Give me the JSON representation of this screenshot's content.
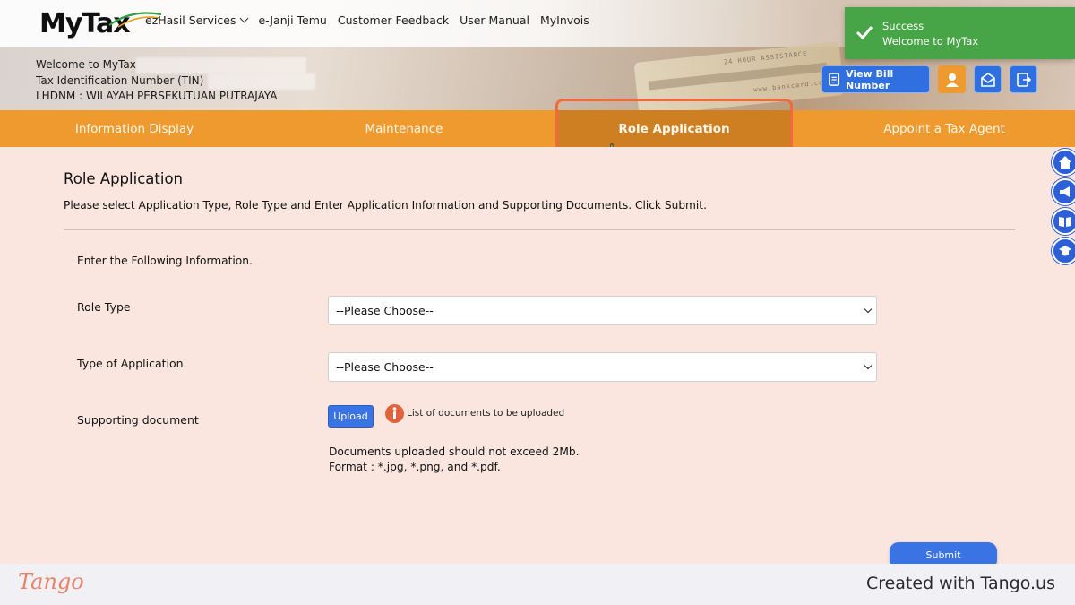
{
  "header": {
    "logo": "MyTax",
    "nav": [
      {
        "label": "ezHasil Services",
        "has_dropdown": true
      },
      {
        "label": "e-Janji Temu",
        "has_dropdown": false
      },
      {
        "label": "Customer Feedback",
        "has_dropdown": false
      },
      {
        "label": "User Manual",
        "has_dropdown": false
      },
      {
        "label": "MyInvois",
        "has_dropdown": false
      }
    ],
    "welcome_line": "Welcome to MyTax",
    "tin_line": "Tax Identification Number (TIN)",
    "lhdnm_line": "LHDNM : WILAYAH PERSEKUTUAN PUTRAJAYA",
    "view_bill_label": "View Bill Number",
    "icons": [
      "profile-icon",
      "mail-icon",
      "logout-icon"
    ]
  },
  "toast": {
    "title": "Success",
    "message": "Welcome to MyTax",
    "color": "#47a447"
  },
  "main_nav": {
    "tabs": [
      {
        "label": "Information Display",
        "active": false
      },
      {
        "label": "Maintenance",
        "active": false
      },
      {
        "label": "Role Application",
        "active": true
      },
      {
        "label": "Appoint a Tax Agent",
        "active": false
      }
    ],
    "color": "#ee9a2e",
    "active_color": "#cd7f22"
  },
  "content": {
    "title": "Role Application",
    "description": "Please select Application Type, Role Type and Enter Application Information and Supporting Documents. Click Submit.",
    "form_intro": "Enter the Following Information.",
    "fields": {
      "role_type": {
        "label": "Role Type",
        "value": "--Please Choose--"
      },
      "type_of_application": {
        "label": "Type of Application",
        "value": "--Please Choose--"
      },
      "supporting_document": {
        "label": "Supporting document"
      }
    },
    "upload_label": "Upload",
    "upload_note": "List of documents to be uploaded",
    "size_note": "Documents uploaded should not exceed 2Mb.",
    "format_note": "Format : *.jpg, *.png, and *.pdf.",
    "submit_label": "Submit"
  },
  "side_buttons": [
    "home-icon",
    "megaphone-icon",
    "book-icon",
    "graduation-icon"
  ],
  "footer": {
    "brand": "Tango",
    "created_with": "Created with Tango.us"
  }
}
